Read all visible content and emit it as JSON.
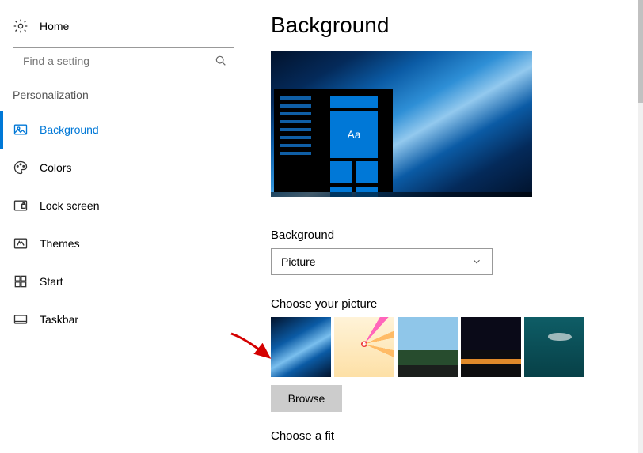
{
  "sidebar": {
    "home_label": "Home",
    "search_placeholder": "Find a setting",
    "section_title": "Personalization",
    "items": [
      {
        "label": "Background",
        "selected": true
      },
      {
        "label": "Colors",
        "selected": false
      },
      {
        "label": "Lock screen",
        "selected": false
      },
      {
        "label": "Themes",
        "selected": false
      },
      {
        "label": "Start",
        "selected": false
      },
      {
        "label": "Taskbar",
        "selected": false
      }
    ]
  },
  "main": {
    "page_title": "Background",
    "preview_sample_text": "Aa",
    "background_label": "Background",
    "background_value": "Picture",
    "choose_picture_label": "Choose your picture",
    "browse_label": "Browse",
    "fit_label": "Choose a fit"
  }
}
